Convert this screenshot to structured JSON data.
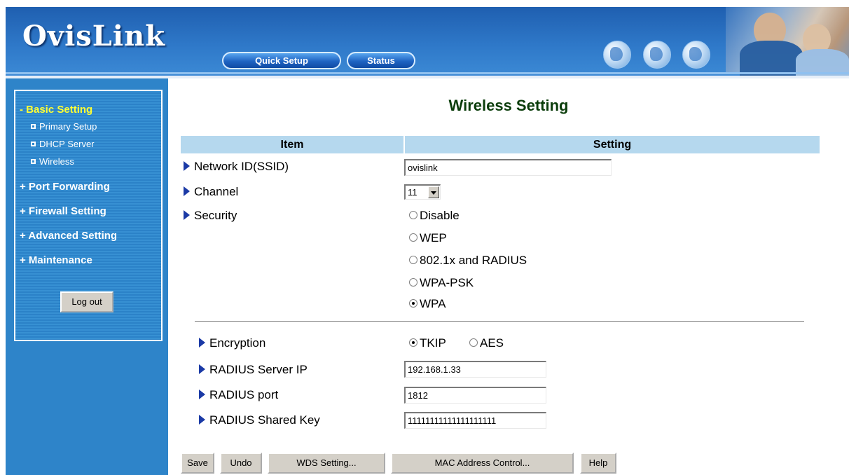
{
  "header": {
    "logo": "OvisLink",
    "nav": [
      "Quick Setup",
      "Status"
    ]
  },
  "sidebar": {
    "menu": [
      {
        "label": "- Basic Setting",
        "active": true
      },
      {
        "label": "+ Port Forwarding"
      },
      {
        "label": "+ Firewall Setting"
      },
      {
        "label": "+ Advanced Setting"
      },
      {
        "label": "+ Maintenance"
      }
    ],
    "submenu": [
      "Primary Setup",
      "DHCP Server",
      "Wireless"
    ],
    "logout": "Log out"
  },
  "main": {
    "title": "Wireless Setting",
    "headers": {
      "item": "Item",
      "setting": "Setting"
    },
    "ssid": {
      "label": "Network ID(SSID)",
      "value": "ovislink"
    },
    "channel": {
      "label": "Channel",
      "value": "11"
    },
    "security": {
      "label": "Security",
      "options": [
        "Disable",
        "WEP",
        "802.1x and RADIUS",
        "WPA-PSK",
        "WPA"
      ],
      "selected": "WPA"
    },
    "encryption": {
      "label": "Encryption",
      "options": [
        "TKIP",
        "AES"
      ],
      "selected": "TKIP"
    },
    "radius_ip": {
      "label": "RADIUS Server IP",
      "value": "192.168.1.33"
    },
    "radius_port": {
      "label": "RADIUS port",
      "value": "1812"
    },
    "radius_key": {
      "label": "RADIUS Shared Key",
      "value": "11111111111111111111"
    },
    "buttons": [
      "Save",
      "Undo",
      "WDS Setting...",
      "MAC Address Control...",
      "Help"
    ]
  },
  "colors": {
    "header_blue": "#2f79c9",
    "sidebar_blue": "#2e84c9",
    "table_header": "#b5d8ee",
    "active_menu": "#ffff33",
    "title_green": "#0b3d0b"
  }
}
